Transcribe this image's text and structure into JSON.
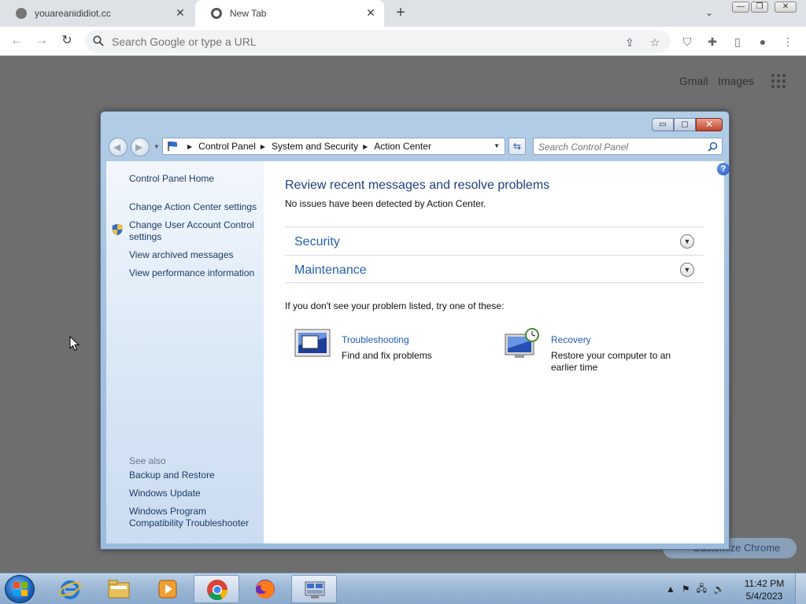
{
  "browser": {
    "tabs": [
      {
        "title": "youareanididiot.cc",
        "close": "✕"
      },
      {
        "title": "New Tab",
        "close": "✕"
      }
    ],
    "new_tab_label": "+",
    "tab_search_glyph": "⌄",
    "window_controls": [
      "—",
      "❐",
      "✕"
    ],
    "omnibox_placeholder": "Search Google or type a URL",
    "ntp_links": {
      "gmail": "Gmail",
      "images": "Images"
    },
    "customize_label": "Customize Chrome"
  },
  "control_panel": {
    "caption_buttons": [
      "▭",
      "▢",
      "✕"
    ],
    "breadcrumbs": [
      "Control Panel",
      "System and Security",
      "Action Center"
    ],
    "search_placeholder": "Search Control Panel",
    "left_pane": {
      "home": "Control Panel Home",
      "links": [
        "Change Action Center settings",
        "Change User Account Control settings",
        "View archived messages",
        "View performance information"
      ],
      "see_also_label": "See also",
      "see_also": [
        "Backup and Restore",
        "Windows Update",
        "Windows Program Compatibility Troubleshooter"
      ]
    },
    "main": {
      "title": "Review recent messages and resolve problems",
      "subtitle": "No issues have been detected by Action Center.",
      "sections": [
        "Security",
        "Maintenance"
      ],
      "try_prompt": "If you don't see your problem listed, try one of these:",
      "tools": [
        {
          "link": "Troubleshooting",
          "desc": "Find and fix problems"
        },
        {
          "link": "Recovery",
          "desc": "Restore your computer to an earlier time"
        }
      ],
      "help_glyph": "?"
    }
  },
  "taskbar": {
    "clock_time": "11:42 PM",
    "clock_date": "5/4/2023",
    "tray_glyphs": [
      "▲",
      "⚑",
      "🖧",
      "🔊"
    ]
  },
  "colors": {
    "link": "#1f5bb5",
    "title": "#1e3f7a",
    "left_link": "#1d3b66"
  }
}
